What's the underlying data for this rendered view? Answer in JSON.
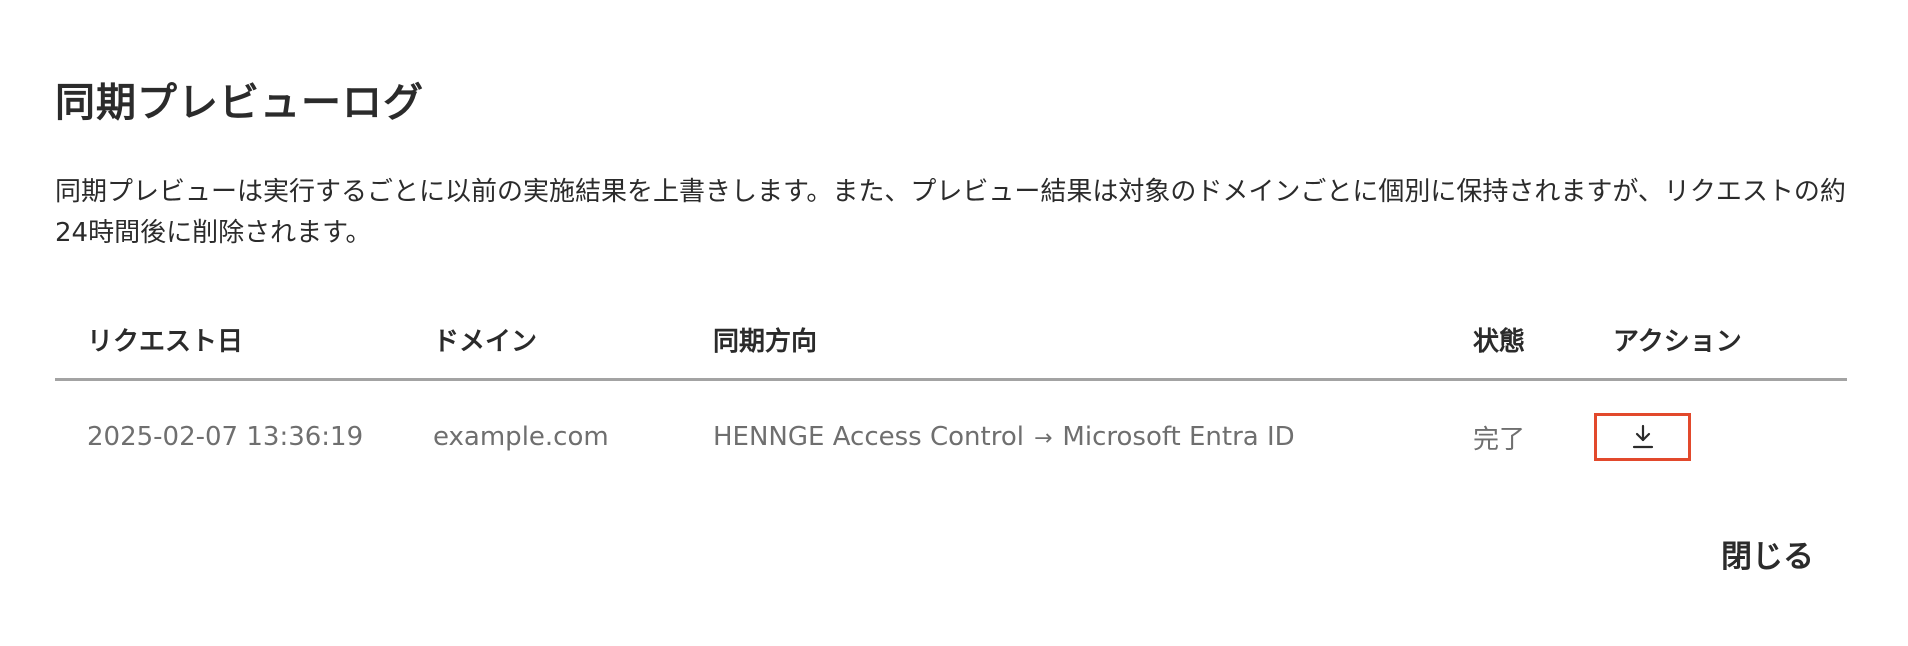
{
  "dialog": {
    "title": "同期プレビューログ",
    "description": "同期プレビューは実行するごとに以前の実施結果を上書きします。また、プレビュー結果は対象のドメインごとに個別に保持されますが、リクエストの約24時間後に削除されます。",
    "close_label": "閉じる"
  },
  "table": {
    "headers": {
      "date": "リクエスト日",
      "domain": "ドメイン",
      "direction": "同期方向",
      "status": "状態",
      "action": "アクション"
    },
    "rows": [
      {
        "date": "2025-02-07 13:36:19",
        "domain": "example.com",
        "source": "HENNGE Access Control",
        "arrow": "→",
        "target": "Microsoft Entra ID",
        "status": "完了",
        "action_icon": "download-icon"
      }
    ]
  },
  "colors": {
    "highlight_border": "#e2492c",
    "header_rule": "#a3a3a3",
    "text_primary": "#2b2b2b",
    "text_secondary": "#6f6f6f"
  }
}
